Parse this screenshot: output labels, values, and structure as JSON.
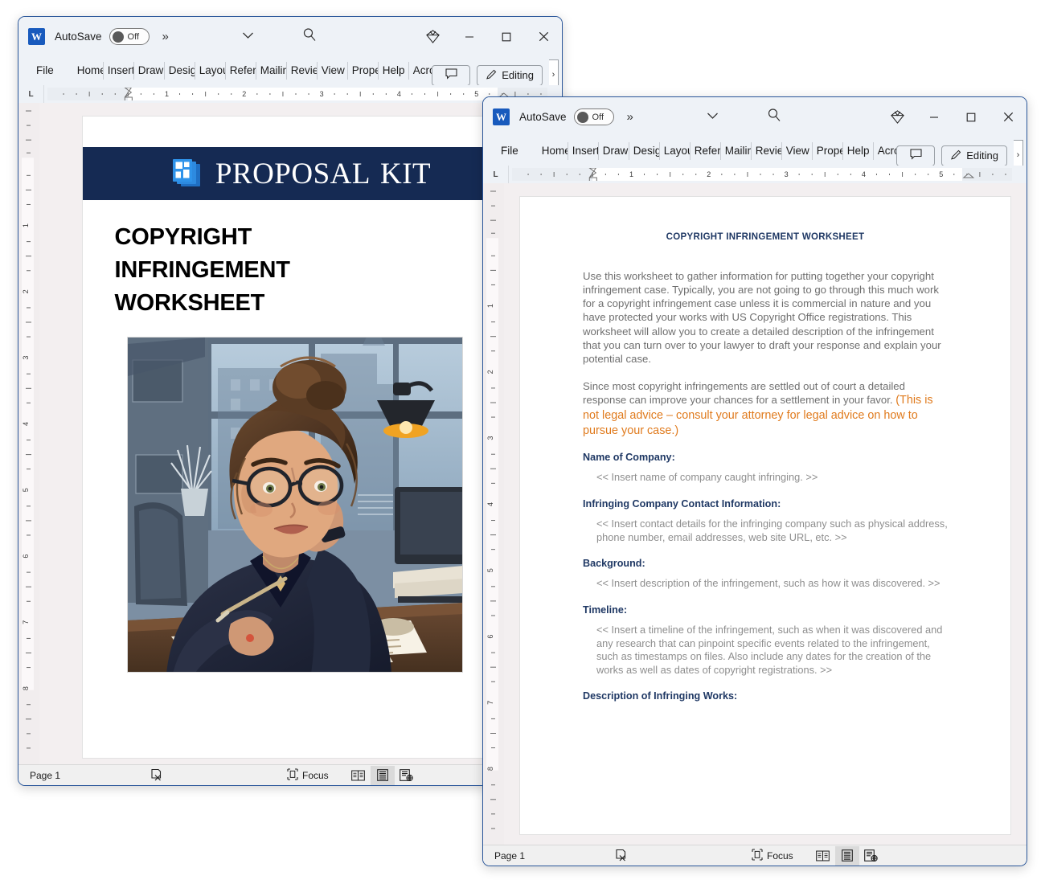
{
  "window_back": {
    "name": "word-window-back",
    "titlebar": {
      "app_icon": "word-logo-icon",
      "autosave_label": "AutoSave",
      "autosave_state": "Off",
      "overflow_glyph": "»",
      "chevron_glyph": "⌄",
      "search_icon": "search-icon",
      "diamond_icon": "diamond-icon",
      "minimize_glyph": "─",
      "maximize_glyph": "□",
      "close_glyph": "✕"
    },
    "ribbon": {
      "tabs": [
        "File",
        "Home",
        "Insert",
        "Draw",
        "Design",
        "Layout",
        "References",
        "Mailings",
        "Review",
        "View",
        "Properties",
        "Help",
        "Acrobat"
      ],
      "comments_label": "",
      "comments_icon": "comment-icon",
      "editing_label": "Editing",
      "editing_icon": "pencil-icon",
      "overflow_glyph": "›"
    },
    "ruler": {
      "tabstop_marker": "L",
      "h_ticks": [
        "1",
        "2",
        "3",
        "4",
        "5"
      ],
      "v_ticks": [
        "1",
        "2",
        "3",
        "4",
        "5",
        "6",
        "7",
        "8"
      ]
    },
    "document": {
      "banner_brand_primary": "PROPOSAL",
      "banner_brand_secondary": "KIT",
      "banner_color": "#152a53",
      "title_lines": [
        "COPYRIGHT",
        "INFRINGEMENT",
        "WORKSHEET"
      ],
      "illustration_alt": "illustration of a frustrated woman with glasses at an office desk writing on papers"
    },
    "statusbar": {
      "page_label": "Page 1",
      "proofing_icon": "proofing-errors-icon",
      "focus_label": "Focus",
      "focus_icon": "focus-icon",
      "view_read_icon": "read-mode-icon",
      "view_print_icon": "print-layout-icon",
      "view_web_icon": "web-layout-icon"
    }
  },
  "window_front": {
    "name": "word-window-front",
    "titlebar": {
      "app_icon": "word-logo-icon",
      "autosave_label": "AutoSave",
      "autosave_state": "Off",
      "overflow_glyph": "»",
      "chevron_glyph": "⌄",
      "search_icon": "search-icon",
      "diamond_icon": "diamond-icon",
      "minimize_glyph": "─",
      "maximize_glyph": "□",
      "close_glyph": "✕"
    },
    "ribbon": {
      "tabs": [
        "File",
        "Home",
        "Insert",
        "Draw",
        "Design",
        "Layout",
        "References",
        "Mailings",
        "Review",
        "View",
        "Properties",
        "Help",
        "Acrobat"
      ],
      "comments_icon": "comment-icon",
      "editing_label": "Editing",
      "editing_icon": "pencil-icon",
      "overflow_glyph": "›"
    },
    "ruler": {
      "tabstop_marker": "L",
      "h_ticks": [
        "1",
        "2",
        "3",
        "4",
        "5"
      ],
      "v_ticks": [
        "1",
        "2",
        "3",
        "4",
        "5",
        "6",
        "7",
        "8"
      ]
    },
    "document": {
      "heading": "COPYRIGHT INFRINGEMENT WORKSHEET",
      "paragraph_1": "Use this worksheet to gather information for putting together your copyright infringement case. Typically, you are not going to go through this much work for a copyright infringement case unless it is commercial in nature and you have protected your works with US Copyright Office registrations. This worksheet will allow you to create a detailed description of the infringement that you can turn over to your lawyer to draft your response and explain your potential case.",
      "paragraph_2_plain": "Since most copyright infringements are settled out of court a detailed response can improve your chances for a settlement in your favor. ",
      "paragraph_2_orange": "(This is not legal advice  – consult your attorney for legal advice on how to pursue your case.)",
      "orange_color": "#e07b1e",
      "heading_color": "#1f3864",
      "sections": [
        {
          "label": "Name of Company:",
          "instruction": "<< Insert name of company caught infringing. >>"
        },
        {
          "label": "Infringing Company Contact Information:",
          "instruction": "<< Insert contact details for the infringing company such as physical address, phone number, email addresses, web site URL, etc. >>"
        },
        {
          "label": "Background:",
          "instruction": "<< Insert description of the infringement, such as how it was discovered. >>"
        },
        {
          "label": "Timeline:",
          "instruction": "<< Insert a timeline of the infringement, such as when it was discovered and any research that can pinpoint specific events related to the infringement, such as timestamps on files. Also include any dates for the creation of the works as well as dates of copyright registrations. >>"
        },
        {
          "label": "Description of Infringing Works:",
          "instruction": ""
        }
      ]
    },
    "statusbar": {
      "page_label": "Page 1",
      "proofing_icon": "proofing-errors-icon",
      "focus_label": "Focus",
      "focus_icon": "focus-icon",
      "view_read_icon": "read-mode-icon",
      "view_print_icon": "print-layout-icon",
      "view_web_icon": "web-layout-icon"
    }
  }
}
